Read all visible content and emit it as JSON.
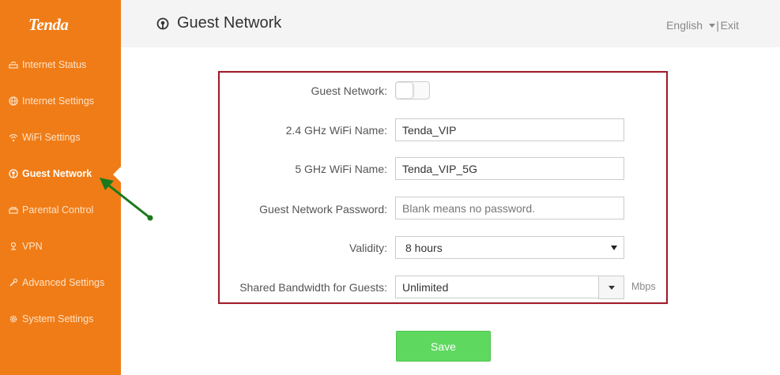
{
  "sidebar": {
    "logo": "Tenda",
    "items": [
      {
        "label": "Internet Status",
        "icon": "router-icon"
      },
      {
        "label": "Internet Settings",
        "icon": "globe-icon"
      },
      {
        "label": "WiFi Settings",
        "icon": "wifi-icon"
      },
      {
        "label": "Guest Network",
        "icon": "guest-network-icon",
        "active": true
      },
      {
        "label": "Parental Control",
        "icon": "parental-icon"
      },
      {
        "label": "VPN",
        "icon": "vpn-icon"
      },
      {
        "label": "Advanced Settings",
        "icon": "wrench-icon"
      },
      {
        "label": "System Settings",
        "icon": "gear-icon"
      }
    ]
  },
  "header": {
    "title": "Guest Network",
    "language": "English",
    "separator": "|",
    "exit": "Exit"
  },
  "form": {
    "guest_network_label": "Guest Network:",
    "guest_network_enabled": false,
    "wifi24_label": "2.4 GHz WiFi Name:",
    "wifi24_value": "Tenda_VIP",
    "wifi5_label": "5 GHz WiFi Name:",
    "wifi5_value": "Tenda_VIP_5G",
    "password_label": "Guest Network Password:",
    "password_placeholder": "Blank means no password.",
    "validity_label": "Validity:",
    "validity_value": "8 hours",
    "bandwidth_label": "Shared Bandwidth for Guests:",
    "bandwidth_value": "Unlimited",
    "bandwidth_unit": "Mbps"
  },
  "save_label": "Save",
  "colors": {
    "sidebar": "#f07c17",
    "highlight_border": "#a01a2a",
    "save_button": "#5fd85f",
    "annotation_arrow": "#1a7a1a"
  }
}
